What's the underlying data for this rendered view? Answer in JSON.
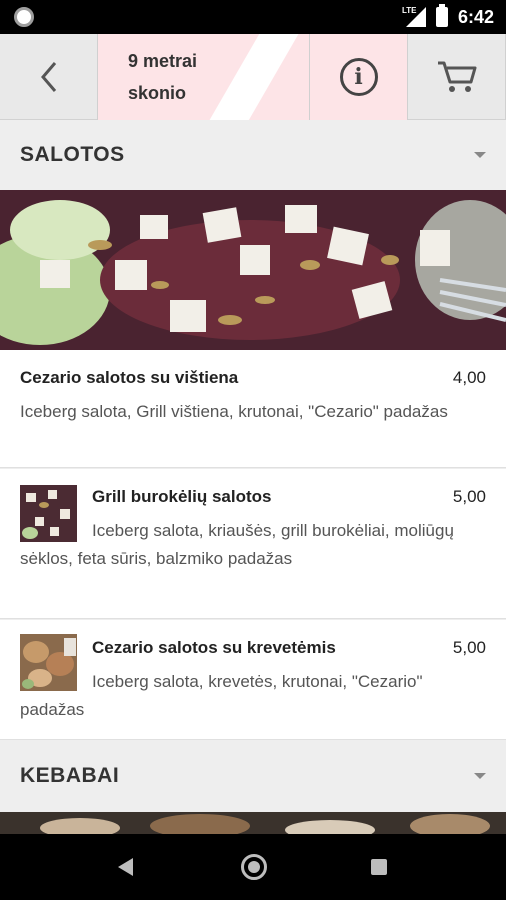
{
  "status_bar": {
    "network_label": "LTE",
    "time": "6:42"
  },
  "app_bar": {
    "title": "9 metrai skonio",
    "icons": {
      "back": "chevron-left-icon",
      "info": "info-icon",
      "cart": "cart-icon"
    }
  },
  "colors": {
    "title_bg": "#fde4e7",
    "header_bg": "#eeeeee",
    "card_bg": "#ffffff"
  },
  "sections": [
    {
      "title": "SALOTOS",
      "items": [
        {
          "name": "Cezario salotos su vištiena",
          "price": "4,00",
          "description": "Iceberg salota, Grill vištiena, krutonai, \"Cezario\" padažas"
        },
        {
          "name": "Grill burokėlių salotos",
          "price": "5,00",
          "description": "Iceberg salota, kriaušės, grill burokėliai, moliūgų sėklos, feta sūris, balzmiko padažas"
        },
        {
          "name": "Cezario salotos su krevetėmis",
          "price": "5,00",
          "description": "Iceberg salota, krevetės, krutonai, \"Cezario\" padažas"
        }
      ]
    },
    {
      "title": "KEBABAI"
    }
  ]
}
